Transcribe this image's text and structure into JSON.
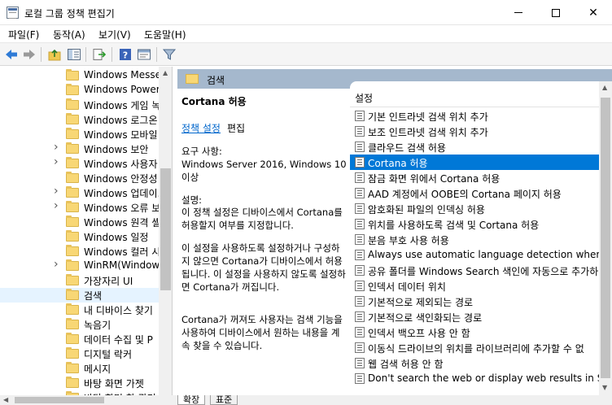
{
  "window": {
    "title": "로컬 그룹 정책 편집기",
    "minimize_icon": "minimize-icon",
    "maximize_icon": "maximize-icon",
    "close_glyph": "✕"
  },
  "menu": [
    "파일(F)",
    "동작(A)",
    "보기(V)",
    "도움말(H)"
  ],
  "tree": {
    "items": [
      {
        "label": "Windows Messer",
        "expandable": false
      },
      {
        "label": "Windows PowerS",
        "expandable": false
      },
      {
        "label": "Windows 게임 녹",
        "expandable": false
      },
      {
        "label": "Windows 로그온",
        "expandable": false
      },
      {
        "label": "Windows 모바일",
        "expandable": false
      },
      {
        "label": "Windows 보안",
        "expandable": true
      },
      {
        "label": "Windows 사용자",
        "expandable": true
      },
      {
        "label": "Windows 안정성",
        "expandable": false
      },
      {
        "label": "Windows 업데이.",
        "expandable": true
      },
      {
        "label": "Windows 오류 보",
        "expandable": true
      },
      {
        "label": "Windows 원격 셸",
        "expandable": false
      },
      {
        "label": "Windows 일정",
        "expandable": false
      },
      {
        "label": "Windows 컬러 시",
        "expandable": false
      },
      {
        "label": "WinRM(Windows",
        "expandable": true
      },
      {
        "label": "가장자리 UI",
        "expandable": false
      },
      {
        "label": "검색",
        "expandable": false,
        "selected": true
      },
      {
        "label": "내 디바이스 찾기",
        "expandable": false
      },
      {
        "label": "녹음기",
        "expandable": false
      },
      {
        "label": "데이터 수집 및 P",
        "expandable": false
      },
      {
        "label": "디지털 락커",
        "expandable": false
      },
      {
        "label": "메시지",
        "expandable": false
      },
      {
        "label": "바탕 화면 가젯",
        "expandable": false
      },
      {
        "label": "바탕 화면 창 관리",
        "expandable": false
      }
    ]
  },
  "header": {
    "title": "검색"
  },
  "description": {
    "title": "Cortana 허용",
    "link": "정책 설정",
    "edit_suffix": "편집",
    "req_label": "요구 사항:",
    "req_value": "Windows Server 2016, Windows 10 이상",
    "desc_label": "설명:",
    "desc_p1": "이 정책 설정은 디바이스에서 Cortana를 허용할지 여부를 지정합니다.",
    "desc_p2": "이 설정을 사용하도록 설정하거나 구성하지 않으면 Cortana가 디바이스에서 허용됩니다. 이 설정을 사용하지 않도록 설정하면 Cortana가 꺼집니다.",
    "desc_p3": "Cortana가 꺼져도 사용자는 검색 기능을 사용하여 디바이스에서 원하는 내용을 계속 찾을 수 있습니다."
  },
  "settings": {
    "header": "설정",
    "items": [
      {
        "label": "기본 인트라넷 검색 위치 추가"
      },
      {
        "label": "보조 인트라넷 검색 위치 추가"
      },
      {
        "label": "클라우드 검색 허용"
      },
      {
        "label": "Cortana 허용",
        "selected": true
      },
      {
        "label": "잠금 화면 위에서 Cortana 허용"
      },
      {
        "label": "AAD 계정에서 OOBE의 Cortana 페이지 허용"
      },
      {
        "label": "암호화된 파일의 인덱싱 허용"
      },
      {
        "label": "위치를 사용하도록 검색 및 Cortana 허용"
      },
      {
        "label": "분음 부호 사용 허용"
      },
      {
        "label": "Always use automatic language detection when inde"
      },
      {
        "label": "공유 폴더를 Windows Search 색인에 자동으로 추가하"
      },
      {
        "label": "인덱서 데이터 위치"
      },
      {
        "label": "기본적으로 제외되는 경로"
      },
      {
        "label": "기본적으로 색인화되는 경로"
      },
      {
        "label": "인덱서 백오프 사용 안 함"
      },
      {
        "label": "이동식 드라이브의 위치를 라이브러리에 추가할 수 없"
      },
      {
        "label": "웹 검색 허용 안 함"
      },
      {
        "label": "Don't search the web or display web results in Searc"
      }
    ]
  },
  "tabs": [
    "확장",
    "표준"
  ]
}
